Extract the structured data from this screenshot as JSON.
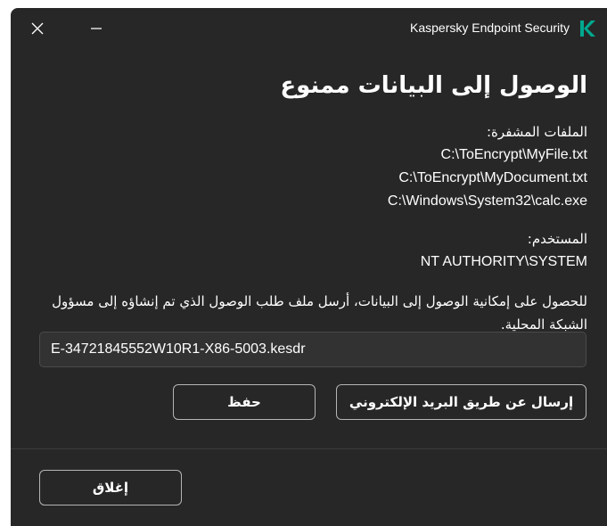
{
  "window": {
    "title": "Kaspersky Endpoint Security",
    "accent_color": "#00a88e"
  },
  "dialog": {
    "heading": "الوصول إلى البيانات ممنوع",
    "encrypted_files_label": "الملفات المشفرة:",
    "encrypted_files": [
      "C:\\ToEncrypt\\MyFile.txt",
      "C:\\ToEncrypt\\MyDocument.txt",
      "C:\\Windows\\System32\\calc.exe"
    ],
    "user_label": "المستخدم:",
    "user_value": "NT AUTHORITY\\SYSTEM",
    "info_text": "للحصول على إمكانية الوصول إلى البيانات، أرسل ملف طلب الوصول الذي تم إنشاؤه إلى مسؤول الشبكة المحلية.",
    "request_file_name": "E-34721845552W10R1-X86-5003.kesdr",
    "send_email_label": "إرسال عن طريق البريد الإلكتروني",
    "save_label": "حفظ",
    "close_label": "إغلاق"
  }
}
